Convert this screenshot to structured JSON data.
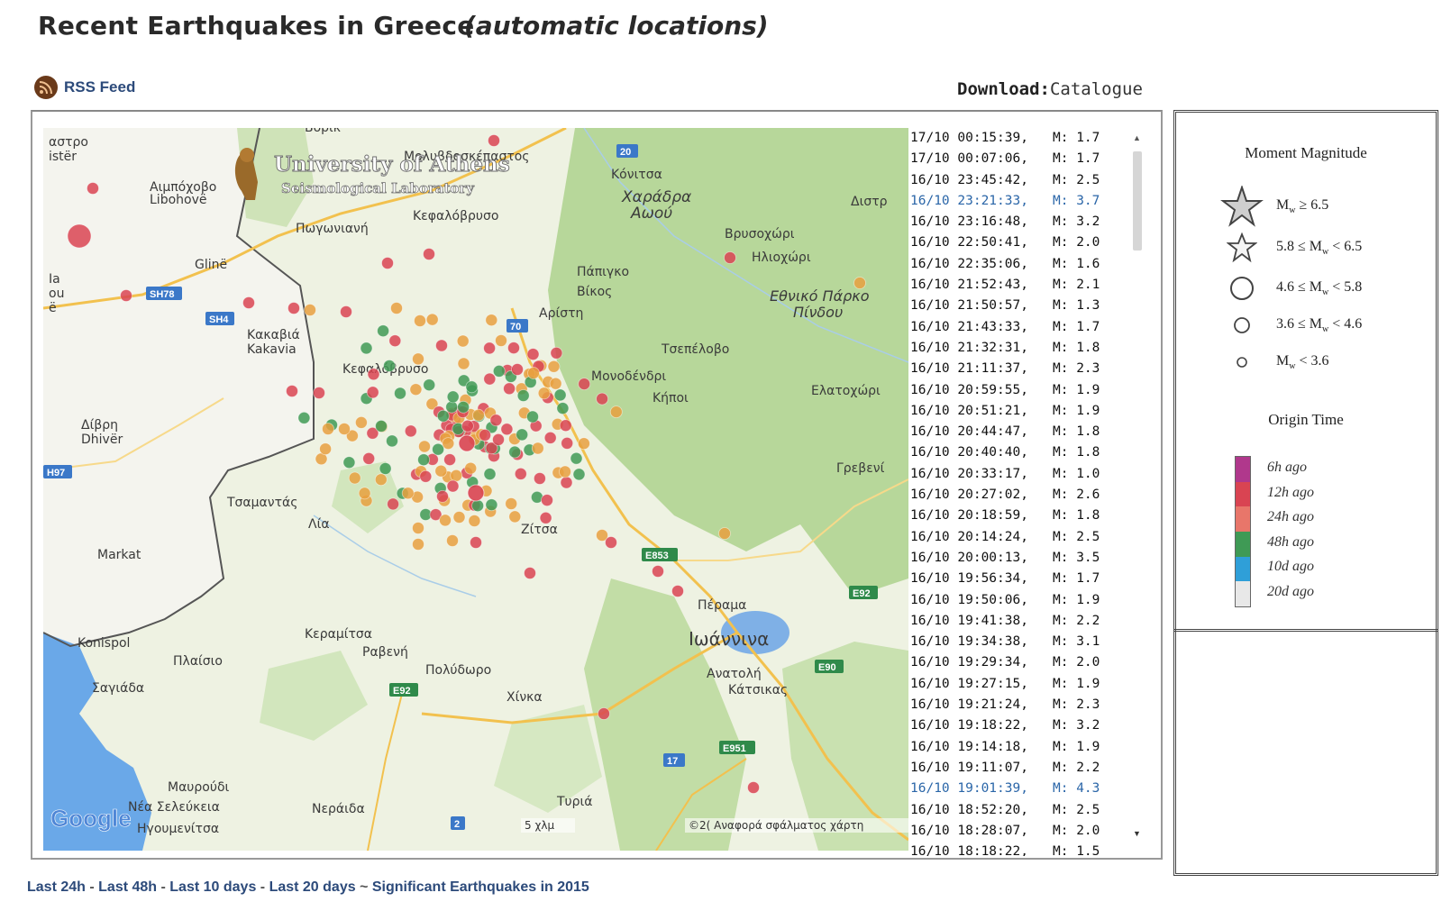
{
  "page": {
    "title": "Recent Earthquakes in Greece",
    "subtitle": "(automatic locations)"
  },
  "rss": {
    "label": "RSS Feed",
    "icon": "rss-icon"
  },
  "download": {
    "label": "Download:",
    "link": "Catalogue"
  },
  "map": {
    "logo_title": "University of Athens",
    "logo_subtitle": "Seismological Laboratory",
    "provider": "Google",
    "scale": "5 χλμ",
    "report": "©2( Αναφορά σφάλματος χάρτη",
    "road_badges": [
      "20",
      "SH78",
      "SH4",
      "70",
      "E853",
      "E92",
      "E90",
      "E92",
      "E951",
      "17",
      "2",
      "H97"
    ],
    "places": [
      "αστρο",
      "istër",
      "Αιμπόχοβο",
      "Libohovë",
      "Μολυβδοσκέπαστος",
      "Κόνιτσα",
      "Χαράδρα",
      "Αωού",
      "Διστρ",
      "Πωγωνιανή",
      "Κεφαλόβρυσο",
      "Βρυσοχώρι",
      "Ηλιοχώρι",
      "Glinë",
      "Πάπιγκο",
      "Βίκος",
      "Εθνικό Πάρκο",
      "Πίνδου",
      "Αρίστη",
      "Κακαβιά",
      "Kakavia",
      "Τσεπέλοβο",
      "Κεφαλόβρυσο",
      "Μονοδένδρι",
      "Κήποι",
      "Ελατοχώρι",
      "Δίβρη",
      "Dhivër",
      "Γρεβενί",
      "Τσαμαντάς",
      "Λία",
      "Ζίτσα",
      "Markat",
      "Πέραμα",
      "Ιωάννινα",
      "Konispol",
      "Κεραμίτσα",
      "Ραβενή",
      "Πλαίσιο",
      "Πολύδωρο",
      "Ανατολή",
      "Κάτσικας",
      "Σαγιάδα",
      "Χίνκα",
      "Μαυρούδι",
      "Νέα Σελεύκεια",
      "Ηγουμενίτσα",
      "Νεράιδα",
      "Τυριά",
      "Ia",
      "ou",
      "ë",
      "Βόρικ"
    ]
  },
  "quakes": [
    {
      "time": "17/10 00:15:39,",
      "mag": "M: 1.7"
    },
    {
      "time": "17/10 00:07:06,",
      "mag": "M: 1.7"
    },
    {
      "time": "16/10 23:45:42,",
      "mag": "M: 2.5"
    },
    {
      "time": "16/10 23:21:33,",
      "mag": "M: 3.7",
      "significant": true
    },
    {
      "time": "16/10 23:16:48,",
      "mag": "M: 3.2"
    },
    {
      "time": "16/10 22:50:41,",
      "mag": "M: 2.0"
    },
    {
      "time": "16/10 22:35:06,",
      "mag": "M: 1.6"
    },
    {
      "time": "16/10 21:52:43,",
      "mag": "M: 2.1"
    },
    {
      "time": "16/10 21:50:57,",
      "mag": "M: 1.3"
    },
    {
      "time": "16/10 21:43:33,",
      "mag": "M: 1.7"
    },
    {
      "time": "16/10 21:32:31,",
      "mag": "M: 1.8"
    },
    {
      "time": "16/10 21:11:37,",
      "mag": "M: 2.3"
    },
    {
      "time": "16/10 20:59:55,",
      "mag": "M: 1.9"
    },
    {
      "time": "16/10 20:51:21,",
      "mag": "M: 1.9"
    },
    {
      "time": "16/10 20:44:47,",
      "mag": "M: 1.8"
    },
    {
      "time": "16/10 20:40:40,",
      "mag": "M: 1.8"
    },
    {
      "time": "16/10 20:33:17,",
      "mag": "M: 1.0"
    },
    {
      "time": "16/10 20:27:02,",
      "mag": "M: 2.6"
    },
    {
      "time": "16/10 20:18:59,",
      "mag": "M: 1.8"
    },
    {
      "time": "16/10 20:14:24,",
      "mag": "M: 2.5"
    },
    {
      "time": "16/10 20:00:13,",
      "mag": "M: 3.5"
    },
    {
      "time": "16/10 19:56:34,",
      "mag": "M: 1.7"
    },
    {
      "time": "16/10 19:50:06,",
      "mag": "M: 1.9"
    },
    {
      "time": "16/10 19:41:38,",
      "mag": "M: 2.2"
    },
    {
      "time": "16/10 19:34:38,",
      "mag": "M: 3.1"
    },
    {
      "time": "16/10 19:29:34,",
      "mag": "M: 2.0"
    },
    {
      "time": "16/10 19:27:15,",
      "mag": "M: 1.9"
    },
    {
      "time": "16/10 19:21:24,",
      "mag": "M: 2.3"
    },
    {
      "time": "16/10 19:18:22,",
      "mag": "M: 3.2"
    },
    {
      "time": "16/10 19:14:18,",
      "mag": "M: 1.9"
    },
    {
      "time": "16/10 19:11:07,",
      "mag": "M: 2.2"
    },
    {
      "time": "16/10 19:01:39,",
      "mag": "M: 4.3",
      "significant": true
    },
    {
      "time": "16/10 18:52:20,",
      "mag": "M: 2.5"
    },
    {
      "time": "16/10 18:28:07,",
      "mag": "M: 2.0"
    },
    {
      "time": "16/10 18:18:22,",
      "mag": "M: 1.5"
    }
  ],
  "legend": {
    "magnitude_title": "Moment Magnitude",
    "magnitude_items": [
      {
        "prefix": "M",
        "sub": "w",
        "suffix": " ≥ 6.5",
        "symbol": "star-large-icon"
      },
      {
        "prefix": "5.8 ≤ M",
        "sub": "w",
        "suffix": " < 6.5",
        "symbol": "star-small-icon"
      },
      {
        "prefix": "4.6 ≤ M",
        "sub": "w",
        "suffix": " < 5.8",
        "symbol": "circle-large-icon"
      },
      {
        "prefix": "3.6 ≤ M",
        "sub": "w",
        "suffix": " < 4.6",
        "symbol": "circle-medium-icon"
      },
      {
        "prefix": "M",
        "sub": "w",
        "suffix": " < 3.6",
        "symbol": "circle-small-icon"
      }
    ],
    "time_title": "Origin Time",
    "time_items": [
      {
        "label": "6h ago",
        "color": "#b0388c"
      },
      {
        "label": "12h ago",
        "color": "#d94452"
      },
      {
        "label": "24h ago",
        "color": "#e8766a"
      },
      {
        "label": "48h ago",
        "color": "#3f9a55"
      },
      {
        "label": "10d ago",
        "color": "#2f9fd8"
      },
      {
        "label": "20d ago",
        "color": "#e8e8e8"
      }
    ]
  },
  "footer": {
    "links": [
      "Last 24h",
      "Last 48h",
      "Last 10 days",
      "Last 20 days"
    ],
    "significant": "Significant Earthquakes in 2015",
    "sep1": " - ",
    "sep2": " ~ "
  },
  "colors": {
    "recent": "#d94452",
    "day": "#e8a040",
    "older": "#3f9a55",
    "land": "#e8f0d8",
    "forest": "#b9d89a",
    "water": "#6aa8e8",
    "border": "#444444"
  }
}
